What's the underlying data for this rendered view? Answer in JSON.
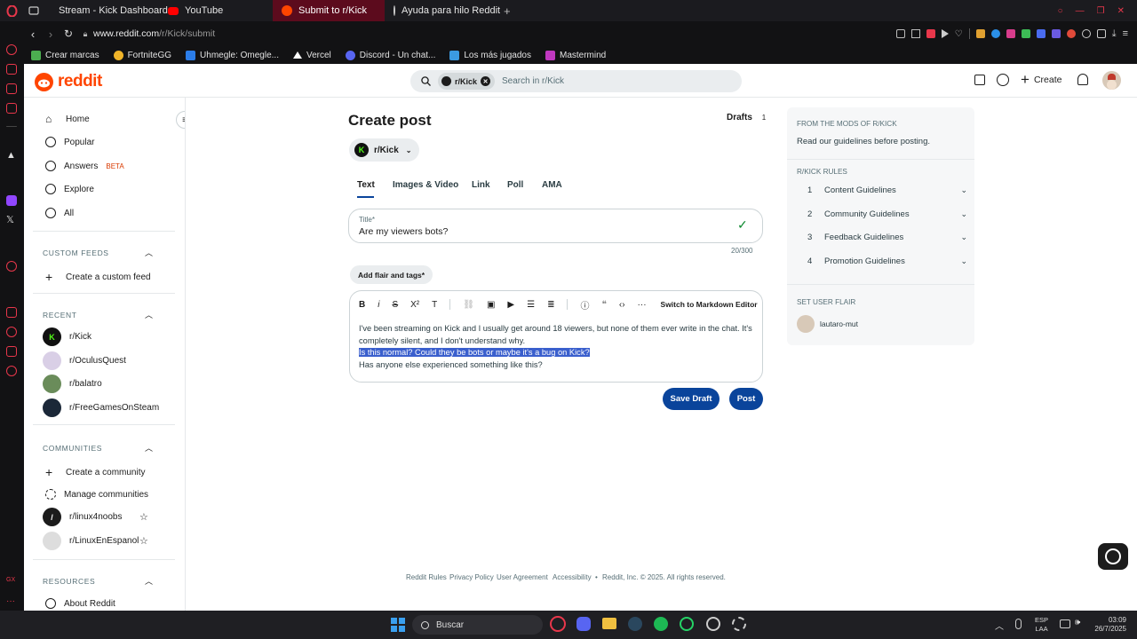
{
  "browser": {
    "tabs": [
      {
        "label": "Stream - Kick Dashboard",
        "icon": "kick-icon",
        "color": "#53fc18"
      },
      {
        "label": "YouTube",
        "icon": "youtube-icon",
        "color": "#ff0000"
      },
      {
        "label": "Submit to r/Kick",
        "icon": "reddit-icon",
        "color": "#ff4500"
      },
      {
        "label": "Ayuda para hilo Reddit",
        "icon": "chatgpt-icon",
        "color": "#cccccc"
      }
    ],
    "url_domain": "www.reddit.com",
    "url_path": "/r/Kick/submit",
    "bookmarks": [
      {
        "label": "Crear marcas",
        "icon": "bookmark-icon",
        "color": "#4caf50"
      },
      {
        "label": "FortniteGG",
        "icon": "fortnite-icon",
        "color": "#f0b429"
      },
      {
        "label": "Uhmegle: Omegle...",
        "icon": "uhmegle-icon",
        "color": "#2b7de9"
      },
      {
        "label": "Vercel",
        "icon": "vercel-icon",
        "color": "#ffffff"
      },
      {
        "label": "Discord - Un chat...",
        "icon": "discord-icon",
        "color": "#5865f2"
      },
      {
        "label": "Los más jugados",
        "icon": "games-icon",
        "color": "#3b9ae1"
      },
      {
        "label": "Mastermind",
        "icon": "mastermind-icon",
        "color": "#c038c0"
      }
    ]
  },
  "reddit": {
    "logo_text": "reddit",
    "search_chip": "r/Kick",
    "search_placeholder": "Search in r/Kick",
    "create_label": "Create"
  },
  "leftnav": {
    "main": [
      {
        "label": "Home",
        "icon": "home-icon"
      },
      {
        "label": "Popular",
        "icon": "popular-icon"
      },
      {
        "label": "Answers",
        "icon": "answers-icon",
        "badge": "BETA"
      },
      {
        "label": "Explore",
        "icon": "explore-icon"
      },
      {
        "label": "All",
        "icon": "all-icon"
      }
    ],
    "custom_feeds_title": "CUSTOM FEEDS",
    "create_custom_feed": "Create a custom feed",
    "recent_title": "RECENT",
    "recent": [
      {
        "label": "r/Kick",
        "color": "#111111"
      },
      {
        "label": "r/OculusQuest",
        "color": "#d9cfe6"
      },
      {
        "label": "r/balatro",
        "color": "#6a8c5a"
      },
      {
        "label": "r/FreeGamesOnSteam",
        "color": "#1b2838"
      }
    ],
    "communities_title": "COMMUNITIES",
    "create_community": "Create a community",
    "manage_communities": "Manage communities",
    "communities": [
      {
        "label": "r/linux4noobs",
        "color": "#1c1c1c"
      },
      {
        "label": "r/LinuxEnEspanol",
        "color": "#dddddd"
      }
    ],
    "resources_title": "RESOURCES",
    "about_reddit": "About Reddit"
  },
  "post": {
    "heading": "Create post",
    "drafts_label": "Drafts",
    "drafts_count": "1",
    "community": "r/Kick",
    "tabs": [
      "Text",
      "Images & Video",
      "Link",
      "Poll",
      "AMA"
    ],
    "active_tab": "Text",
    "title_label": "Title*",
    "title_value": "Are my viewers bots?",
    "title_counter": "20/300",
    "flair_button": "Add flair and tags*",
    "markdown_switch": "Switch to Markdown Editor",
    "body_line1": "I've been streaming on Kick and I usually get around 18 viewers, but none of them ever write in the chat. It's",
    "body_line2": "completely silent, and I don't understand why.",
    "body_line3": "Is this normal? Could they be bots or maybe it's a bug on Kick?",
    "body_line4": "Has anyone else experienced something like this?",
    "save_draft": "Save Draft",
    "post_button": "Post"
  },
  "rightpanel": {
    "mods_title": "FROM THE MODS OF R/KICK",
    "mods_text": "Read our guidelines before posting.",
    "rules_title": "R/KICK RULES",
    "rules": [
      {
        "num": "1",
        "label": "Content Guidelines"
      },
      {
        "num": "2",
        "label": "Community Guidelines"
      },
      {
        "num": "3",
        "label": "Feedback Guidelines"
      },
      {
        "num": "4",
        "label": "Promotion Guidelines"
      }
    ],
    "user_flair_title": "SET USER FLAIR",
    "username": "lautaro-mut"
  },
  "footer": {
    "links": [
      "Reddit Rules",
      "Privacy Policy",
      "User Agreement",
      "Accessibility"
    ],
    "copyright": "Reddit, Inc. © 2025. All rights reserved."
  },
  "taskbar": {
    "search_label": "Buscar",
    "lang_top": "ESP",
    "lang_bottom": "LAA",
    "time": "03:09",
    "date": "26/7/2025"
  },
  "colors": {
    "reddit_orange": "#ff4500",
    "button_blue": "#0a449b",
    "selection": "#3a5fcd",
    "kick_green": "#53fc18"
  }
}
